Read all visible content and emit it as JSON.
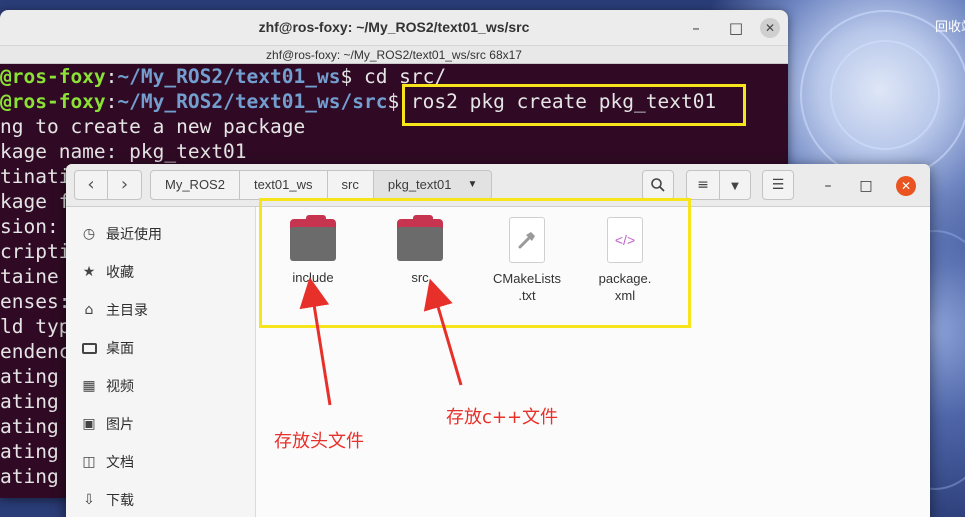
{
  "desktop": {
    "trash_label": "回收站"
  },
  "terminal": {
    "title": "zhf@ros-foxy: ~/My_ROS2/text01_ws/src",
    "subtitle": "zhf@ros-foxy: ~/My_ROS2/text01_ws/src 68x17",
    "lines": [
      {
        "user": "@ros-foxy",
        "sep": ":",
        "path": "~/My_ROS2/text01_ws",
        "rest": "$ cd src/"
      },
      {
        "user": "@ros-foxy",
        "sep": ":",
        "path": "~/My_ROS2/text01_ws/src",
        "rest": "$ ros2 pkg create pkg_text01"
      },
      {
        "text": "ng to create a new package"
      },
      {
        "text": "kage name: pkg_text01"
      },
      {
        "text": "tinati"
      },
      {
        "text": "kage f"
      },
      {
        "text": "sion:"
      },
      {
        "text": "cripti"
      },
      {
        "text": "taine"
      },
      {
        "text": "enses:"
      },
      {
        "text": "ld typ"
      },
      {
        "text": "endenc"
      },
      {
        "text": "ating"
      },
      {
        "text": "ating"
      },
      {
        "text": "ating"
      },
      {
        "text": "ating"
      },
      {
        "text": "ating"
      }
    ]
  },
  "file_manager": {
    "breadcrumbs": [
      "My_ROS2",
      "text01_ws",
      "src",
      "pkg_text01"
    ],
    "sidebar": [
      {
        "label": "最近使用",
        "icon": "clock-icon"
      },
      {
        "label": "收藏",
        "icon": "star-icon"
      },
      {
        "label": "主目录",
        "icon": "home-icon"
      },
      {
        "label": "桌面",
        "icon": "desktop-icon"
      },
      {
        "label": "视频",
        "icon": "video-icon"
      },
      {
        "label": "图片",
        "icon": "picture-icon"
      },
      {
        "label": "文档",
        "icon": "document-icon"
      },
      {
        "label": "下载",
        "icon": "download-icon"
      }
    ],
    "files": [
      {
        "name": "include",
        "type": "folder"
      },
      {
        "name": "src",
        "type": "folder"
      },
      {
        "name": "CMakeLists\n.txt",
        "type": "cmake"
      },
      {
        "name": "package.\nxml",
        "type": "xml"
      }
    ]
  },
  "annotations": {
    "include_note": "存放头文件",
    "src_note": "存放c++文件"
  },
  "colors": {
    "terminal_bg": "#300a24",
    "prompt_user": "#8ae234",
    "prompt_path": "#729fcf",
    "highlight": "#f7e51b",
    "annotation": "#e8302a",
    "folder_tab": "#c7344f",
    "close_button": "#e95420"
  }
}
